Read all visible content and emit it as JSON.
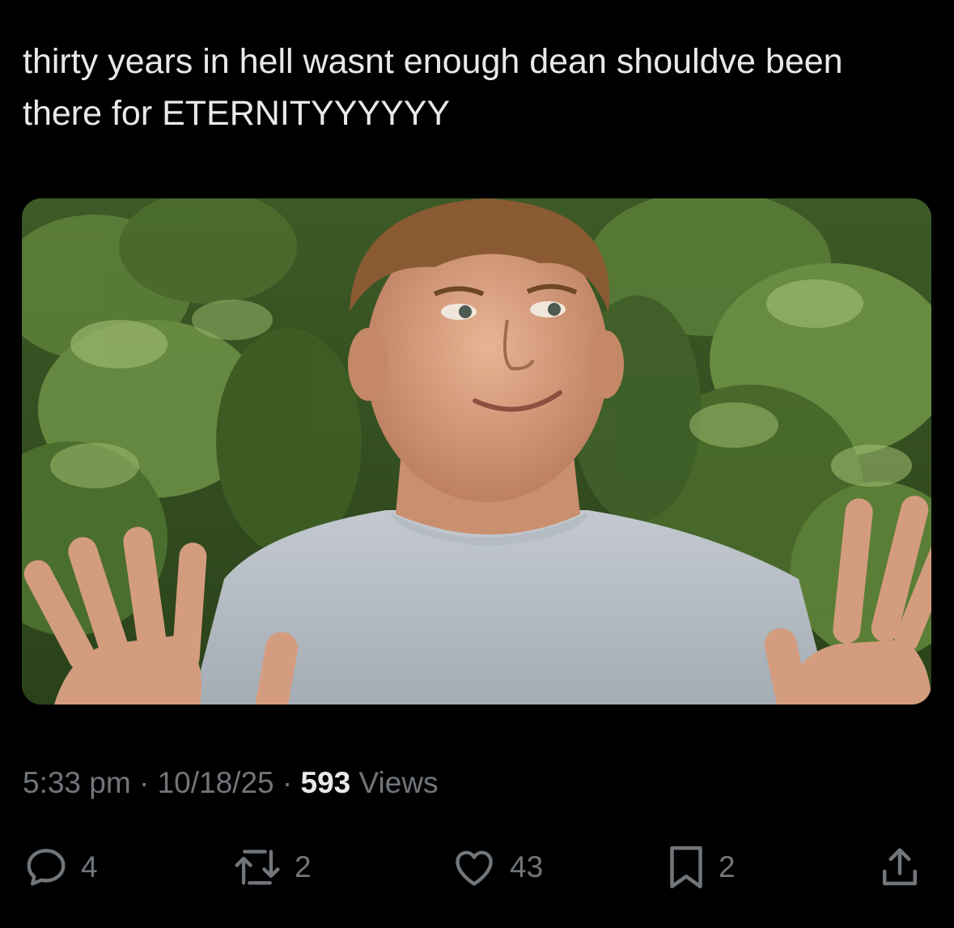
{
  "tweet": {
    "text": "thirty years in hell wasnt enough dean shouldve been there for ETERNITYYYYYY"
  },
  "media": {
    "alt": "young man in grey t-shirt smiling with both hands raised in front of green trees"
  },
  "meta": {
    "time": "5:33 pm",
    "sep1": " · ",
    "date": "10/18/25",
    "sep2": " · ",
    "views_count": "593",
    "views_label": " Views"
  },
  "actions": {
    "reply_count": "4",
    "retweet_count": "2",
    "like_count": "43",
    "bookmark_count": "2",
    "reply_icon": "reply-icon",
    "retweet_icon": "retweet-icon",
    "like_icon": "heart-icon",
    "bookmark_icon": "bookmark-icon",
    "share_icon": "share-icon"
  },
  "colors": {
    "background": "#000000",
    "text": "#e7e9ea",
    "muted": "#71767b"
  }
}
